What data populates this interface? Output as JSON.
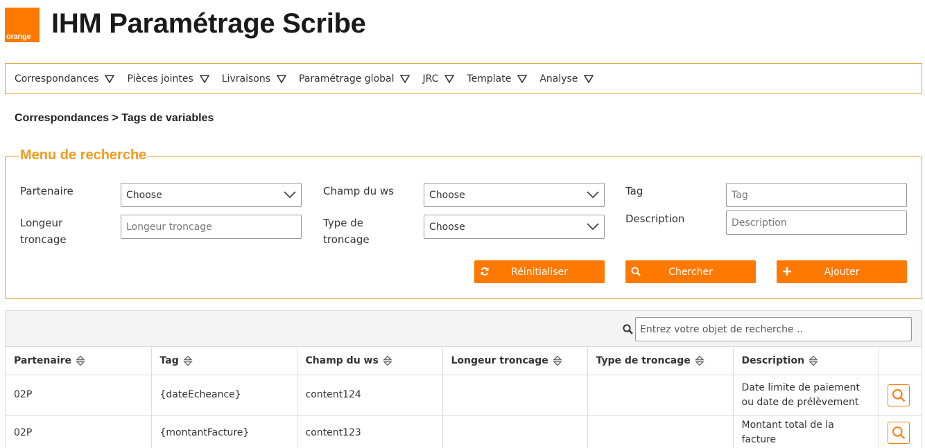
{
  "brand": {
    "logo_text": "orange",
    "color": "#ff7900"
  },
  "app": {
    "title": "IHM Paramétrage Scribe"
  },
  "nav": {
    "items": [
      {
        "label": "Correspondances"
      },
      {
        "label": "Pièces jointes"
      },
      {
        "label": "Livraisons"
      },
      {
        "label": "Paramétrage global"
      },
      {
        "label": "JRC"
      },
      {
        "label": "Template"
      },
      {
        "label": "Analyse"
      }
    ]
  },
  "breadcrumb": "Correspondances > Tags de variables",
  "search": {
    "legend": "Menu de recherche",
    "partenaire": {
      "label": "Partenaire",
      "value": "Choose"
    },
    "longueur": {
      "label_line1": "Longeur",
      "label_line2": "troncage",
      "placeholder": "Longeur troncage"
    },
    "champ_ws": {
      "label": "Champ du ws",
      "value": "Choose"
    },
    "type_troncage": {
      "label_line1": "Type de",
      "label_line2": "troncage",
      "value": "Choose"
    },
    "tag": {
      "label": "Tag",
      "placeholder": "Tag"
    },
    "description": {
      "label": "Description",
      "placeholder": "Description"
    },
    "buttons": {
      "reset": "Réinitialiser",
      "search": "Chercher",
      "add": "Ajouter"
    }
  },
  "table": {
    "search_placeholder": "Entrez votre objet de recherche ..",
    "columns": [
      "Partenaire",
      "Tag",
      "Champ du ws",
      "Longeur troncage",
      "Type de troncage",
      "Description"
    ],
    "rows": [
      {
        "partenaire": "02P",
        "tag": "{dateEcheance}",
        "champ": "content124",
        "longueur": "",
        "type": "",
        "description": "Date limite de paiement ou date de prélèvement"
      },
      {
        "partenaire": "02P",
        "tag": "{montantFacture}",
        "champ": "content123",
        "longueur": "",
        "type": "",
        "description": "Montant total de la facture"
      }
    ]
  }
}
